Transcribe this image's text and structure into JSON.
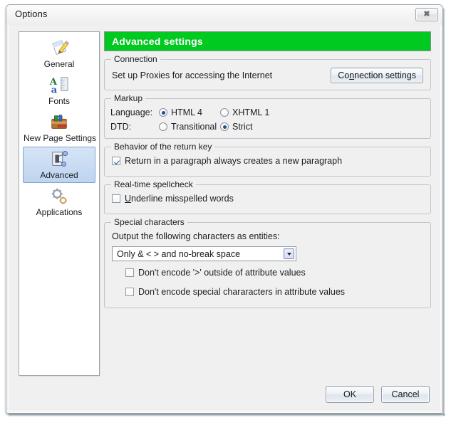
{
  "window": {
    "title": "Options",
    "close_icon": "close-icon",
    "close_glyph": "✖"
  },
  "sidebar": {
    "items": [
      {
        "id": "general",
        "label": "General",
        "icon": "pencil-document-icon",
        "selected": false
      },
      {
        "id": "fonts",
        "label": "Fonts",
        "icon": "font-ruler-icon",
        "selected": false
      },
      {
        "id": "new-page-settings",
        "label": "New Page Settings",
        "icon": "toolbox-icon",
        "selected": false
      },
      {
        "id": "advanced",
        "label": "Advanced",
        "icon": "switch-nodes-icon",
        "selected": true
      },
      {
        "id": "applications",
        "label": "Applications",
        "icon": "gears-icon",
        "selected": false
      }
    ]
  },
  "page": {
    "header_title": "Advanced settings",
    "header_color": "#00c91f"
  },
  "groups": {
    "connection": {
      "title": "Connection",
      "description": "Set up Proxies for accessing the Internet",
      "button_label_before": "Co",
      "button_accel": "n",
      "button_label_after": "nection settings"
    },
    "markup": {
      "title": "Markup",
      "language_label": "Language:",
      "dtd_label": "DTD:",
      "language_options": [
        {
          "label": "HTML 4",
          "checked": true
        },
        {
          "label": "XHTML 1",
          "checked": false
        }
      ],
      "dtd_options": [
        {
          "label": "Transitional",
          "checked": false
        },
        {
          "label": "Strict",
          "checked": true
        }
      ]
    },
    "return_key": {
      "title": "Behavior of the return key",
      "checkbox_label": "Return in a paragraph always creates a new paragraph",
      "checked": true
    },
    "spellcheck": {
      "title": "Real-time spellcheck",
      "checkbox_accel": "U",
      "checkbox_label_after": "nderline misspelled words",
      "checked": false
    },
    "special_characters": {
      "title": "Special characters",
      "description": "Output the following characters as entities:",
      "combo_value": "Only & < > and no-break space",
      "combo_arrow_icon": "chevron-down-icon",
      "checkbox_1_label": "Don't encode '>' outside of attribute values",
      "checkbox_1_checked": false,
      "checkbox_2_label": "Don't encode special chararacters in attribute values",
      "checkbox_2_checked": false
    }
  },
  "footer": {
    "ok_label": "OK",
    "cancel_label": "Cancel"
  }
}
